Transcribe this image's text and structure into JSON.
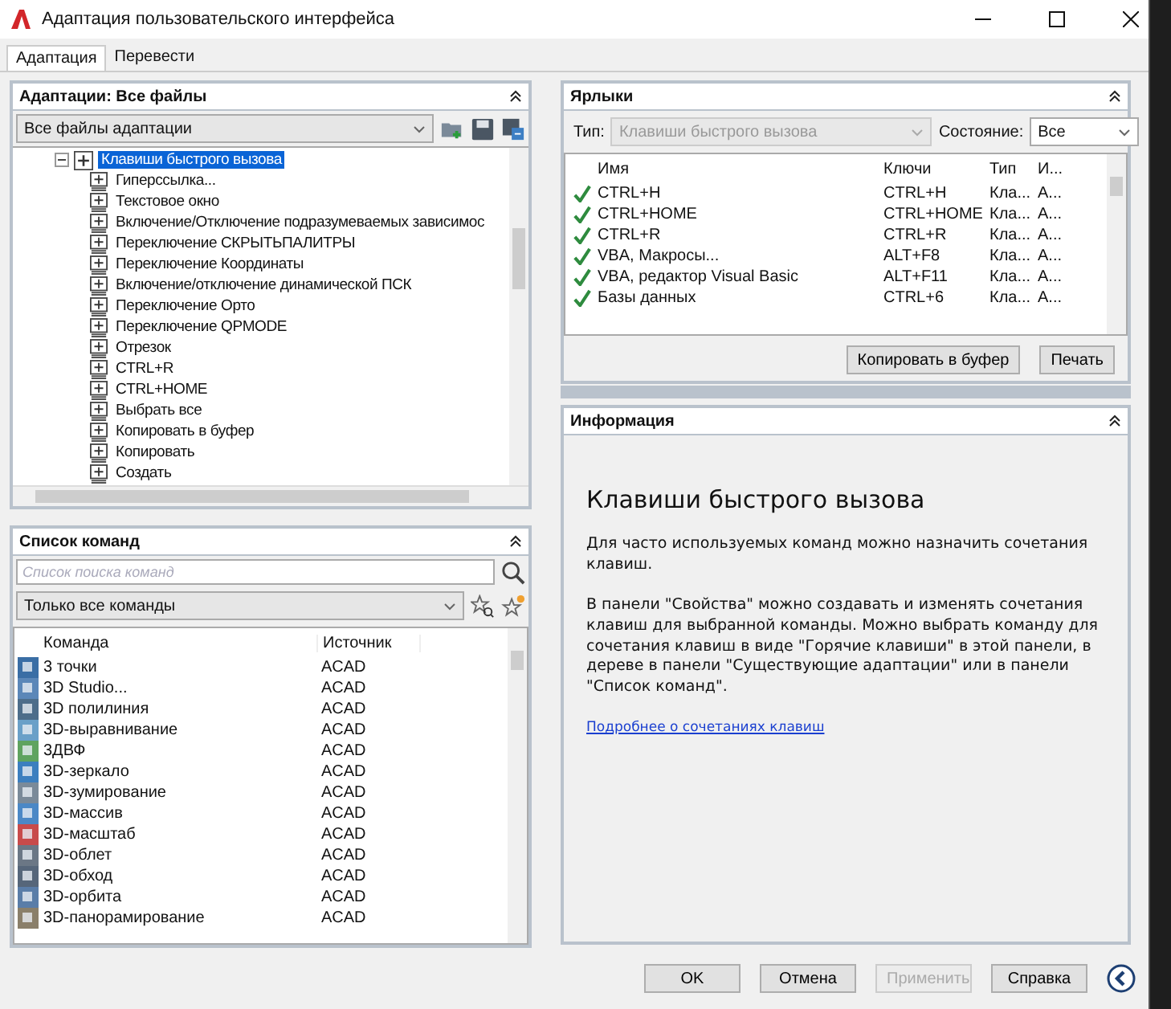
{
  "window": {
    "title": "Адаптация пользовательского интерфейса"
  },
  "tabs": [
    {
      "label": "Адаптация",
      "selected": true
    },
    {
      "label": "Перевести",
      "selected": false
    }
  ],
  "customizations_panel": {
    "title": "Адаптации: Все файлы",
    "dropdown": "Все файлы адаптации",
    "tree": {
      "label": "Клавиши быстрого вызова",
      "expanded": true,
      "selected": true,
      "children": [
        {
          "label": "Гиперссылка...",
          "selected": false
        },
        {
          "label": "Текстовое окно",
          "selected": false
        },
        {
          "label": "Включение/Отключение подразумеваемых зависимос",
          "selected": false
        },
        {
          "label": "Переключение СКРЫТЬПАЛИТРЫ",
          "selected": false
        },
        {
          "label": "Переключение Координаты",
          "selected": false
        },
        {
          "label": "Включение/отключение динамической ПСК",
          "selected": false
        },
        {
          "label": "Переключение Орто",
          "selected": false
        },
        {
          "label": "Переключение QPMODE",
          "selected": false
        },
        {
          "label": "Отрезок",
          "selected": false
        },
        {
          "label": "CTRL+R",
          "selected": false
        },
        {
          "label": "CTRL+HOME",
          "selected": false
        },
        {
          "label": "Выбрать все",
          "selected": false
        },
        {
          "label": "Копировать в буфер",
          "selected": false
        },
        {
          "label": "Копировать",
          "selected": false
        },
        {
          "label": "Создать",
          "selected": false
        }
      ]
    }
  },
  "commands_panel": {
    "title": "Список команд",
    "search": {
      "placeholder": "Список поиска команд"
    },
    "filter": "Только все команды",
    "columns": [
      "Команда",
      "Источник"
    ],
    "rows": [
      {
        "command": "3 точки",
        "source": "ACAD"
      },
      {
        "command": "3D Studio...",
        "source": "ACAD"
      },
      {
        "command": "3D полилиния",
        "source": "ACAD"
      },
      {
        "command": "3D-выравнивание",
        "source": "ACAD"
      },
      {
        "command": "3ДВФ",
        "source": "ACAD"
      },
      {
        "command": "3D-зеркало",
        "source": "ACAD"
      },
      {
        "command": "3D-зумирование",
        "source": "ACAD"
      },
      {
        "command": "3D-массив",
        "source": "ACAD"
      },
      {
        "command": "3D-масштаб",
        "source": "ACAD"
      },
      {
        "command": "3D-облет",
        "source": "ACAD"
      },
      {
        "command": "3D-обход",
        "source": "ACAD"
      },
      {
        "command": "3D-орбита",
        "source": "ACAD"
      },
      {
        "command": "3D-панорамирование",
        "source": "ACAD"
      }
    ]
  },
  "shortcuts_panel": {
    "title": "Ярлыки",
    "type_label": "Тип:",
    "type_value": "Клавиши быстрого вызова",
    "type_disabled": true,
    "state_label": "Состояние:",
    "state_value": "Все",
    "columns": [
      "Имя",
      "Ключи",
      "Тип",
      "И..."
    ],
    "rows": [
      {
        "checked": true,
        "name": "CTRL+H",
        "keys": "CTRL+H",
        "type": "Кла...",
        "column_4": "А..."
      },
      {
        "checked": true,
        "name": "CTRL+HOME",
        "keys": "CTRL+HOME",
        "type": "Кла...",
        "column_4": "А..."
      },
      {
        "checked": true,
        "name": "CTRL+R",
        "keys": "CTRL+R",
        "type": "Кла...",
        "column_4": "А..."
      },
      {
        "checked": true,
        "name": "VBA, Макросы...",
        "keys": "ALT+F8",
        "type": "Кла...",
        "column_4": "А..."
      },
      {
        "checked": true,
        "name": "VBA, редактор Visual Basic",
        "keys": "ALT+F11",
        "type": "Кла...",
        "column_4": "А..."
      },
      {
        "checked": true,
        "name": "Базы данных",
        "keys": "CTRL+6",
        "type": "Кла...",
        "column_4": "А..."
      }
    ],
    "buttons": [
      "Копировать в буфер",
      "Печать"
    ]
  },
  "info_panel": {
    "title": "Информация",
    "heading": "Клавиши быстрого вызова",
    "paragraphs": [
      "Для часто используемых команд можно назначить сочетания клавиш.",
      "В панели \"Свойства\" можно создавать и изменять сочетания клавиш для выбранной команды. Можно выбрать команду для сочетания клавиш в виде \"Горячие клавиши\" в этой панели, в дереве в панели \"Существующие адаптации\" или в панели \"Список команд\"."
    ],
    "link": "Подробнее о сочетаниях клавиш"
  },
  "footer_buttons": [
    {
      "label": "OK",
      "disabled": false
    },
    {
      "label": "Отмена",
      "disabled": false
    },
    {
      "label": "Применить",
      "disabled": true
    },
    {
      "label": "Справка",
      "disabled": false
    }
  ]
}
